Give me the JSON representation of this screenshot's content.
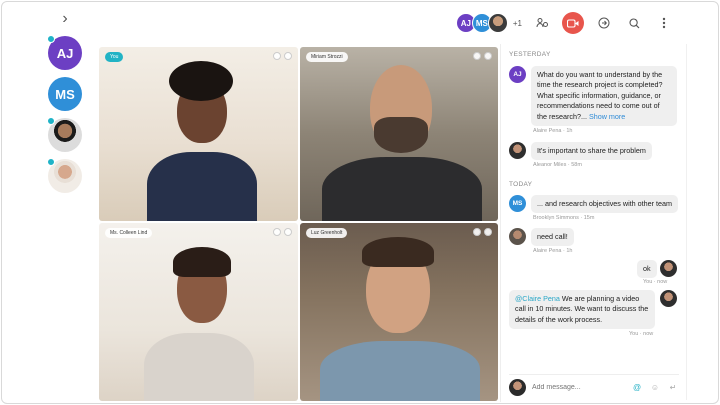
{
  "header": {
    "collapse_icon": "chevron-right-icon",
    "participants": [
      {
        "initials": "AJ",
        "color": "#6c3fc3"
      },
      {
        "initials": "MS",
        "color": "#2f8fd8"
      },
      {
        "initials": "",
        "color": "#444444"
      }
    ],
    "participant_extra": "+1",
    "icons": [
      "people-settings-icon",
      "video-camera-icon",
      "share-icon",
      "search-icon",
      "more-vertical-icon"
    ],
    "video_color": "#e8554c"
  },
  "rail": [
    {
      "initials": "AJ",
      "color": "#6c3fc3",
      "online": true
    },
    {
      "initials": "MS",
      "color": "#2f8fd8",
      "online": false
    },
    {
      "initials": "",
      "color": "",
      "online": true
    },
    {
      "initials": "",
      "color": "",
      "online": true
    }
  ],
  "tiles": [
    {
      "label": "You"
    },
    {
      "label": "Miriam Strozzi"
    },
    {
      "label": "Ms. Colleen Lind"
    },
    {
      "label": "Luz Greenholt"
    }
  ],
  "chat": {
    "yesterday_label": "YESTERDAY",
    "today_label": "TODAY",
    "m1": {
      "initials": "AJ",
      "color": "#6c3fc3",
      "text": "What do you want to understand by the time the research project is completed? What specific information, guidance, or recommendations need to come out of the research?...",
      "show_more": "Show more",
      "meta": "Alaire Pena · 1h"
    },
    "m2": {
      "text": "It's important to share the problem",
      "meta": "Aleanor Miles · 58m"
    },
    "m3": {
      "initials": "MS",
      "color": "#2f8fd8",
      "text": "... and research objectives with other team",
      "meta": "Brooklyn Simmons · 15m"
    },
    "m4": {
      "text": "need call!",
      "meta": "Alaire Pena · 1h"
    },
    "m5": {
      "text": "ok",
      "meta": "You · now"
    },
    "m6": {
      "mention": "@Claire Pena",
      "text": " We are planning a video call in 10 minutes. We want to discuss the details of the work process.",
      "meta": "You · now"
    },
    "composer_placeholder": "Add message...",
    "accent": "#25b1c6"
  }
}
